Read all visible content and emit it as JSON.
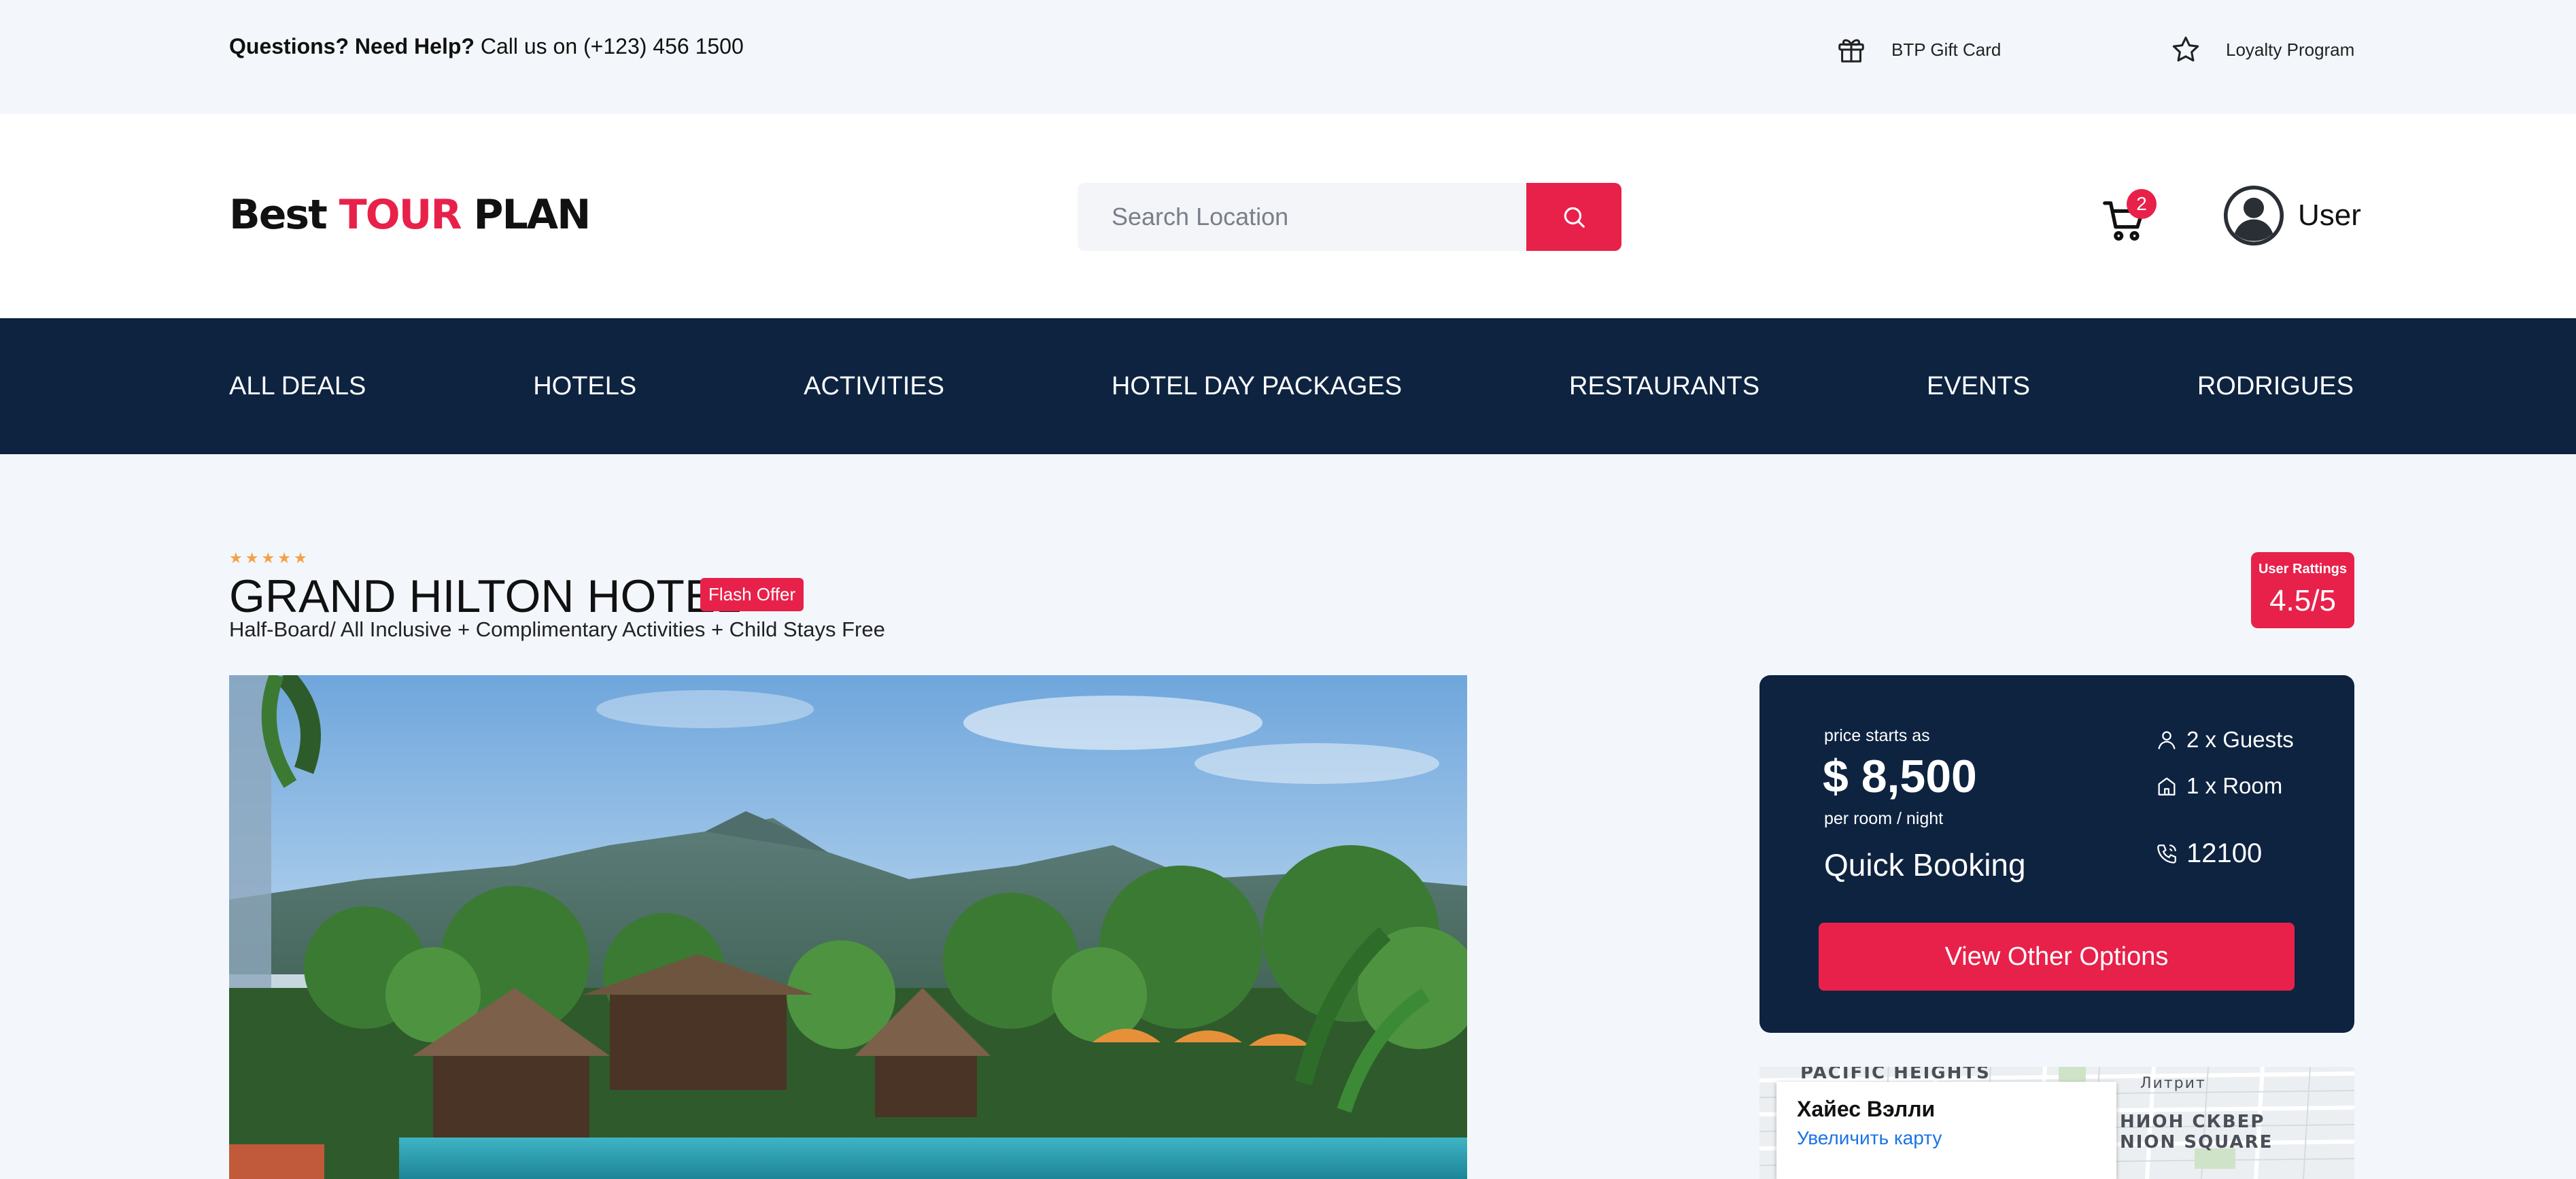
{
  "topbar": {
    "help_bold": "Questions? Need Help?",
    "help_text": " Call us on (+123) 456 1500",
    "gift_label": "BTP Gift Card",
    "loyalty_label": "Loyalty Program",
    "icons": [
      "gift-icon",
      "star-icon"
    ]
  },
  "header": {
    "logo": {
      "word1": "Best ",
      "word2": "TOUR",
      "word3": " PLAN"
    },
    "search": {
      "placeholder": "Search Location",
      "value": ""
    },
    "cart_count": "2",
    "user_label": "User",
    "icons": [
      "search-icon",
      "cart-icon",
      "user-avatar-icon"
    ]
  },
  "nav": {
    "items": [
      "ALL DEALS",
      "HOTELS",
      "ACTIVITIES",
      "HOTEL DAY PACKAGES",
      "RESTAURANTS",
      "EVENTS",
      "RODRIGUES"
    ]
  },
  "hotel": {
    "stars": 5,
    "name": "GRAND HILTON HOTEL",
    "badge": "Flash Offer",
    "subtitle": "Half-Board/ All Inclusive + Complimentary Activities + Child Stays Free",
    "rating_label": "User Rattings",
    "rating_value": "4.5/5"
  },
  "booking": {
    "starts_label": "price starts as",
    "price": "$ 8,500",
    "per_label": "per room / night",
    "quick_label": "Quick Booking",
    "guests": "2 x Guests",
    "rooms": "1 x Room",
    "phone": "12100",
    "button": "View Other Options",
    "icons": [
      "person-icon",
      "home-icon",
      "phone-icon"
    ]
  },
  "map": {
    "place_name": "Хайес Вэлли",
    "enlarge_link": "Увеличить карту",
    "label_top": "PACIFIC HEIGHTS",
    "label_right_1": "Литрит",
    "label_right_2": "НИОН СКВЕР",
    "label_right_3": "NION SQUARE"
  },
  "colors": {
    "accent": "#e8214a",
    "navy": "#0d2340",
    "page_bg": "#f3f7fc",
    "star": "#f5a044"
  }
}
